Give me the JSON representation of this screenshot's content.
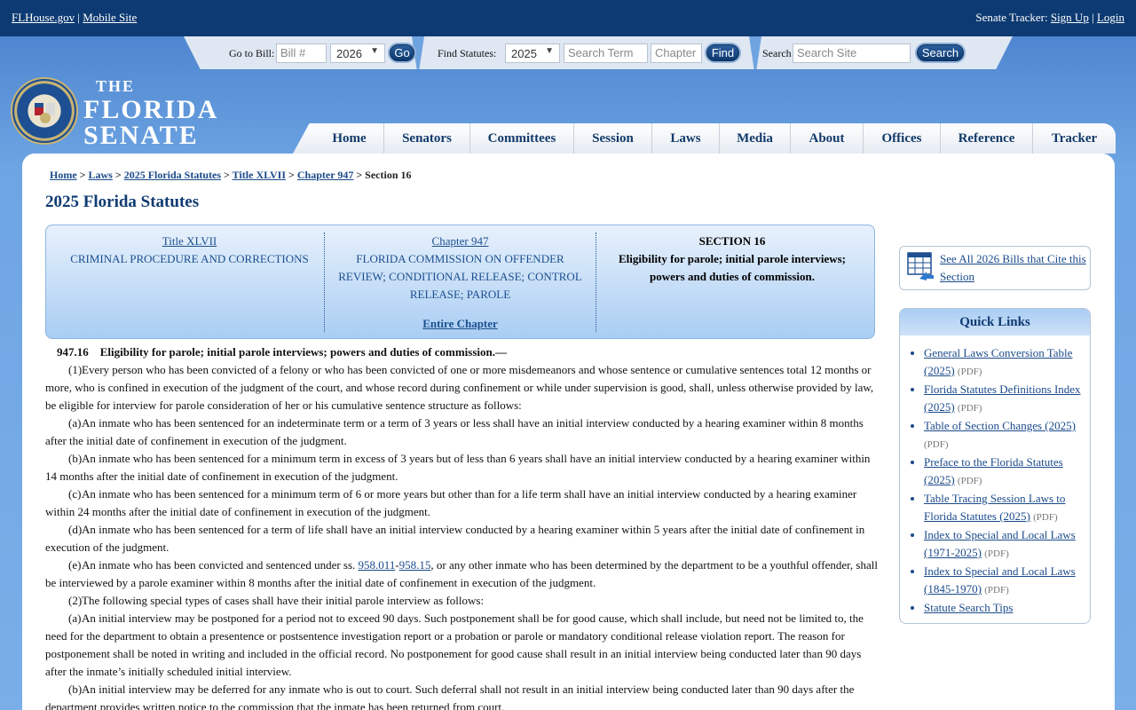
{
  "topbar": {
    "site_link": "FLHouse.gov",
    "sep": "|",
    "mobile_link": "Mobile Site",
    "tracker_label": "Senate Tracker:",
    "signup": "Sign Up",
    "login": "Login"
  },
  "search": {
    "goto_label": "Go to Bill:",
    "bill_placeholder": "Bill #",
    "bill_year": "2026",
    "go": "Go",
    "find_label": "Find Statutes:",
    "statute_year": "2025",
    "term_placeholder": "Search Term",
    "chapter_placeholder": "Chapter",
    "find": "Find",
    "site_label": "Search",
    "site_placeholder": "Search Site",
    "search": "Search"
  },
  "logo": {
    "the": "THE",
    "florida": "FLORIDA",
    "senate": "SENATE"
  },
  "nav": [
    "Home",
    "Senators",
    "Committees",
    "Session",
    "Laws",
    "Media",
    "About",
    "Offices",
    "Reference",
    "Tracker"
  ],
  "breadcrumb": {
    "home": "Home",
    "laws": "Laws",
    "statutes": "2025 Florida Statutes",
    "title": "Title XLVII",
    "chapter": "Chapter 947",
    "current": "Section 16",
    "sep": ">"
  },
  "page_title": "2025 Florida Statutes",
  "infobox": {
    "title_link": "Title XLVII",
    "title_name": "CRIMINAL PROCEDURE AND CORRECTIONS",
    "chapter_link": "Chapter 947",
    "chapter_name": "FLORIDA COMMISSION ON OFFENDER REVIEW; CONDITIONAL RELEASE; CONTROL RELEASE; PAROLE",
    "entire_chapter": "Entire Chapter",
    "section_label": "SECTION 16",
    "section_name": "Eligibility for parole; initial parole interviews; powers and duties of commission."
  },
  "law": {
    "heading_num": "947.16",
    "heading_text": "Eligibility for parole; initial parole interviews; powers and duties of commission.—",
    "p1_num": "(1)",
    "p1": "Every person who has been convicted of a felony or who has been convicted of one or more misdemeanors and whose sentence or cumulative sentences total 12 months or more, who is confined in execution of the judgment of the court, and whose record during confinement or while under supervision is good, shall, unless otherwise provided by law, be eligible for interview for parole consideration of her or his cumulative sentence structure as follows:",
    "a_num": "(a)",
    "a": "An inmate who has been sentenced for an indeterminate term or a term of 3 years or less shall have an initial interview conducted by a hearing examiner within 8 months after the initial date of confinement in execution of the judgment.",
    "b_num": "(b)",
    "b": "An inmate who has been sentenced for a minimum term in excess of 3 years but of less than 6 years shall have an initial interview conducted by a hearing examiner within 14 months after the initial date of confinement in execution of the judgment.",
    "c_num": "(c)",
    "c": "An inmate who has been sentenced for a minimum term of 6 or more years but other than for a life term shall have an initial interview conducted by a hearing examiner within 24 months after the initial date of confinement in execution of the judgment.",
    "d_num": "(d)",
    "d": "An inmate who has been sentenced for a term of life shall have an initial interview conducted by a hearing examiner within 5 years after the initial date of confinement in execution of the judgment.",
    "e_num": "(e)",
    "e_pre": "An inmate who has been convicted and sentenced under ss.",
    "e_link1": "958.011",
    "e_dash": "-",
    "e_link2": "958.15",
    "e_post": ", or any other inmate who has been determined by the department to be a youthful offender, shall be interviewed by a parole examiner within 8 months after the initial date of confinement in execution of the judgment.",
    "p2_num": "(2)",
    "p2": "The following special types of cases shall have their initial parole interview as follows:",
    "p2a_num": "(a)",
    "p2a": "An initial interview may be postponed for a period not to exceed 90 days. Such postponement shall be for good cause, which shall include, but need not be limited to, the need for the department to obtain a presentence or postsentence investigation report or a probation or parole or mandatory conditional release violation report. The reason for postponement shall be noted in writing and included in the official record. No postponement for good cause shall result in an initial interview being conducted later than 90 days after the inmate’s initially scheduled initial interview.",
    "p2b_num": "(b)",
    "p2b": "An initial interview may be deferred for any inmate who is out to court. Such deferral shall not result in an initial interview being conducted later than 90 days after the department provides written notice to the commission that the inmate has been returned from court."
  },
  "sidebar": {
    "cite_text": "See All 2026 Bills that Cite this Section",
    "quick_links_title": "Quick Links",
    "pdf_label": "(PDF)",
    "links": [
      {
        "text": "General Laws Conversion Table (2025)",
        "pdf": true
      },
      {
        "text": "Florida Statutes Definitions Index (2025)",
        "pdf": true
      },
      {
        "text": "Table of Section Changes (2025)",
        "pdf": true
      },
      {
        "text": "Preface to the Florida Statutes (2025)",
        "pdf": true
      },
      {
        "text": "Table Tracing Session Laws to Florida Statutes (2025)",
        "pdf": true
      },
      {
        "text": "Index to Special and Local Laws (1971-2025)",
        "pdf": true
      },
      {
        "text": "Index to Special and Local Laws (1845-1970)",
        "pdf": true
      },
      {
        "text": "Statute Search Tips",
        "pdf": false
      }
    ]
  }
}
